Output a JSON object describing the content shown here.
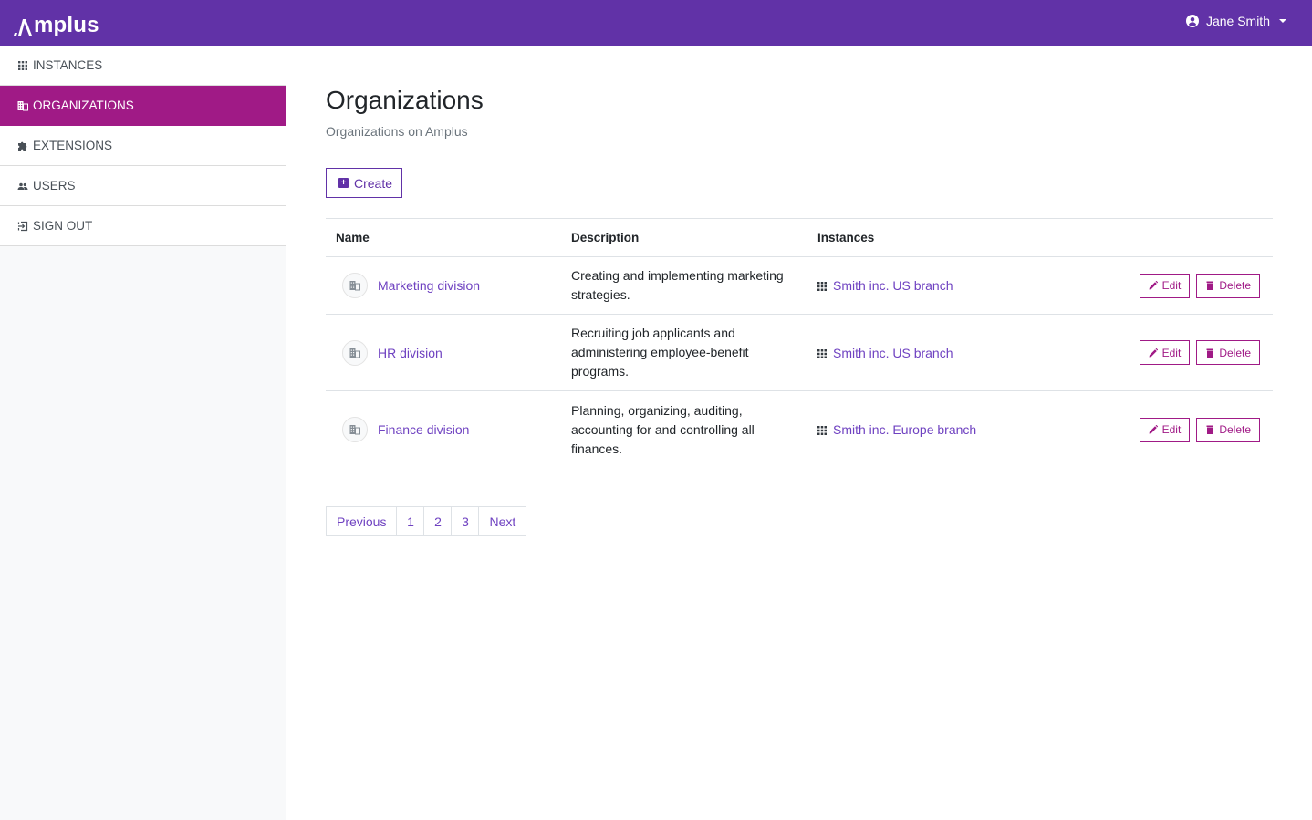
{
  "app": {
    "brand": "Amplus",
    "brand_color": "#6132a7",
    "accent_color": "#a01a86",
    "link_color": "#6f42c1"
  },
  "header": {
    "logo_text": "mplus",
    "user": {
      "name": "Jane Smith",
      "icon": "user-circle-icon"
    }
  },
  "sidebar": {
    "items": [
      {
        "label": "INSTANCES",
        "icon": "grid-icon",
        "active": false
      },
      {
        "label": "ORGANIZATIONS",
        "icon": "building-icon",
        "active": true
      },
      {
        "label": "EXTENSIONS",
        "icon": "puzzle-icon",
        "active": false
      },
      {
        "label": "USERS",
        "icon": "users-icon",
        "active": false
      },
      {
        "label": "SIGN OUT",
        "icon": "sign-out-icon",
        "active": false
      }
    ]
  },
  "main": {
    "title": "Organizations",
    "subtitle": "Organizations on Amplus",
    "create_label": "Create",
    "table": {
      "columns": [
        "Name",
        "Description",
        "Instances",
        ""
      ],
      "rows": [
        {
          "name": "Marketing division",
          "description": "Creating and implementing marketing strategies.",
          "instance": "Smith inc. US branch",
          "edit_label": "Edit",
          "delete_label": "Delete"
        },
        {
          "name": "HR division",
          "description": "Recruiting job applicants and administering employee-benefit programs.",
          "instance": "Smith inc. US branch",
          "edit_label": "Edit",
          "delete_label": "Delete"
        },
        {
          "name": "Finance division",
          "description": "Planning, organizing, auditing, accounting for and controlling all finances.",
          "instance": "Smith inc. Europe branch",
          "edit_label": "Edit",
          "delete_label": "Delete"
        }
      ]
    },
    "pagination": {
      "previous": "Previous",
      "pages": [
        "1",
        "2",
        "3"
      ],
      "next": "Next"
    }
  }
}
